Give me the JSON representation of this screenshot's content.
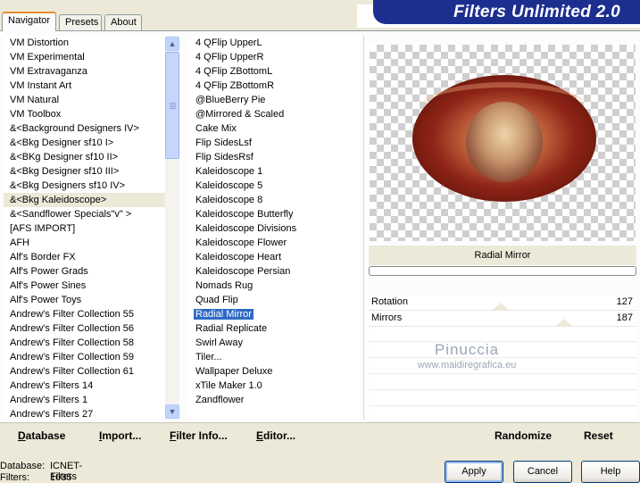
{
  "tabs": [
    {
      "label": "Navigator",
      "active": true
    },
    {
      "label": "Presets",
      "active": false
    },
    {
      "label": "About",
      "active": false
    }
  ],
  "banner": {
    "title": "Filters Unlimited 2.0",
    "color": "#1c2f8f"
  },
  "categories": [
    "VM Distortion",
    "VM Experimental",
    "VM Extravaganza",
    "VM Instant Art",
    "VM Natural",
    "VM Toolbox",
    "&<Background Designers IV>",
    "&<Bkg Designer sf10 I>",
    "&<BKg Designer sf10 II>",
    "&<Bkg Designer sf10 III>",
    "&<Bkg Designers sf10 IV>",
    "&<Bkg Kaleidoscope>",
    "&<Sandflower Specials\"v\" >",
    "[AFS IMPORT]",
    "AFH",
    "Alf's Border FX",
    "Alf's Power Grads",
    "Alf's Power Sines",
    "Alf's Power Toys",
    "Andrew's Filter Collection 55",
    "Andrew's Filter Collection 56",
    "Andrew's Filter Collection 58",
    "Andrew's Filter Collection 59",
    "Andrew's Filter Collection 61",
    "Andrew's Filters 14",
    "Andrew's Filters 1",
    "Andrew's Filters 27"
  ],
  "selected_category": "&<Bkg Kaleidoscope>",
  "filters": [
    "4 QFlip UpperL",
    "4 QFlip UpperR",
    "4 QFlip ZBottomL",
    "4 QFlip ZBottomR",
    "@BlueBerry Pie",
    "@Mirrored & Scaled",
    "Cake Mix",
    "Flip SidesLsf",
    "Flip SidesRsf",
    "Kaleidoscope 1",
    "Kaleidoscope 5",
    "Kaleidoscope 8",
    "Kaleidoscope Butterfly",
    "Kaleidoscope Divisions",
    "Kaleidoscope Flower",
    "Kaleidoscope Heart",
    "Kaleidoscope Persian",
    "Nomads Rug",
    "Quad Flip",
    "Radial Mirror",
    "Radial Replicate",
    "Swirl Away",
    "Tiler...",
    "Wallpaper Deluxe",
    "xTile Maker 1.0",
    "Zandflower"
  ],
  "selected_filter": "Radial Mirror",
  "preview": {
    "filter_name": "Radial Mirror",
    "progress": 0
  },
  "params": [
    {
      "label": "Rotation",
      "value": "127"
    },
    {
      "label": "Mirrors",
      "value": "187"
    }
  ],
  "watermark": {
    "line1": "Pinuccia",
    "line2": "www.maidiregrafica.eu"
  },
  "bottom_links": {
    "database": "Database",
    "import": "Import...",
    "filter_info": "Filter Info...",
    "editor": "Editor...",
    "randomize": "Randomize",
    "reset": "Reset"
  },
  "status": {
    "database_label": "Database:",
    "database_value": "ICNET-Filters",
    "filters_label": "Filters:",
    "filters_value": "1035"
  },
  "buttons": {
    "apply": "Apply",
    "cancel": "Cancel",
    "help": "Help"
  }
}
